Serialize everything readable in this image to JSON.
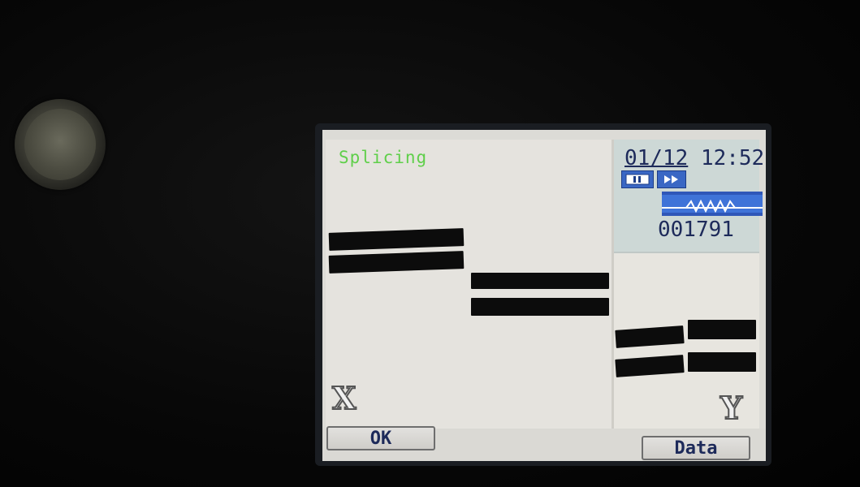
{
  "screen": {
    "mode_title": "Splicing",
    "datetime": {
      "date": "01/12",
      "time": "12:52"
    },
    "counter": "001791",
    "x_label": "X",
    "y_label": "Y",
    "icons": [
      "pause-icon",
      "forward-icon",
      "arc-discharge-icon"
    ],
    "buttons": {
      "ok": "OK",
      "data": "Data"
    }
  },
  "colors": {
    "mode_title": "#5fcf4a",
    "status_text": "#1d2a5a",
    "icon_blue": "#3a67c4",
    "fiber": "#0c0c0c"
  }
}
